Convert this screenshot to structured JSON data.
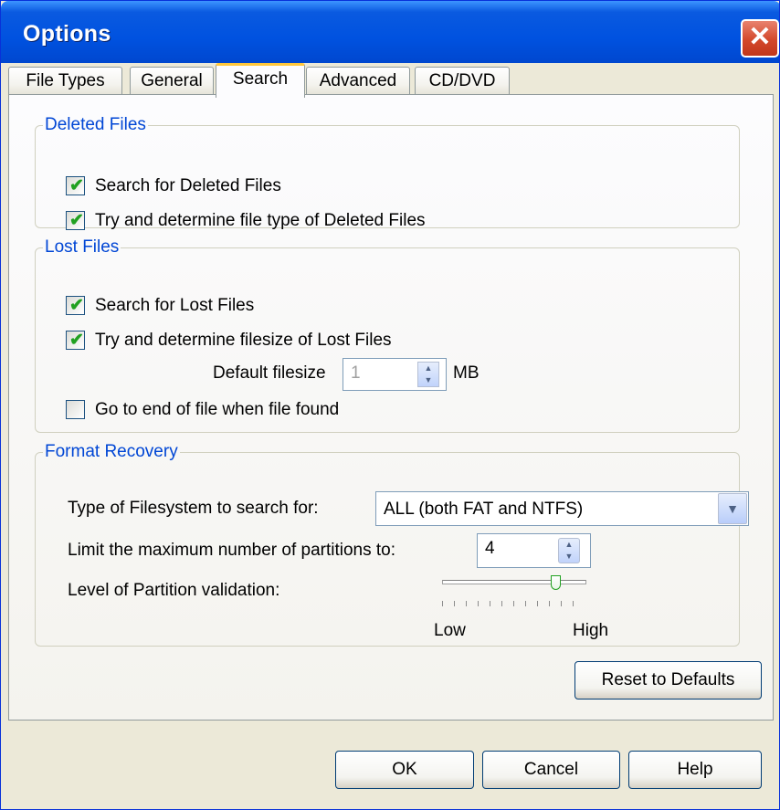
{
  "window": {
    "title": "Options"
  },
  "tabs": [
    "File Types",
    "General",
    "Search",
    "Advanced",
    "CD/DVD"
  ],
  "active_tab": "Search",
  "deleted_files": {
    "legend": "Deleted Files",
    "search_label": "Search for Deleted Files",
    "search_checked": true,
    "type_label": "Try and determine file type of Deleted Files",
    "type_checked": true
  },
  "lost_files": {
    "legend": "Lost Files",
    "search_label": "Search for Lost Files",
    "search_checked": true,
    "size_label": "Try and determine filesize of Lost Files",
    "size_checked": true,
    "default_size_label": "Default filesize",
    "default_size_value": "1",
    "unit": "MB",
    "goto_end_label": "Go to end of file when file found",
    "goto_end_checked": false
  },
  "format_recovery": {
    "legend": "Format Recovery",
    "fs_label": "Type of Filesystem to search for:",
    "fs_value": "ALL  (both FAT and NTFS)",
    "partitions_label": "Limit the maximum number of partitions to:",
    "partitions_value": "4",
    "validation_label": "Level of Partition validation:",
    "validation_level": 0.8,
    "low_label": "Low",
    "high_label": "High"
  },
  "buttons": {
    "reset": "Reset to Defaults",
    "ok": "OK",
    "cancel": "Cancel",
    "help": "Help"
  },
  "icons": {
    "close": "close-icon",
    "check": "checkmark-icon",
    "spin": "spin-arrows-icon",
    "dropdown": "chevron-down-icon",
    "slider": "slider-thumb-icon"
  },
  "colors": {
    "titlebar": "#0052e0",
    "legend": "#0046d5",
    "close": "#d3482b",
    "check": "#21a121",
    "tab_highlight": "#ffc73c"
  }
}
